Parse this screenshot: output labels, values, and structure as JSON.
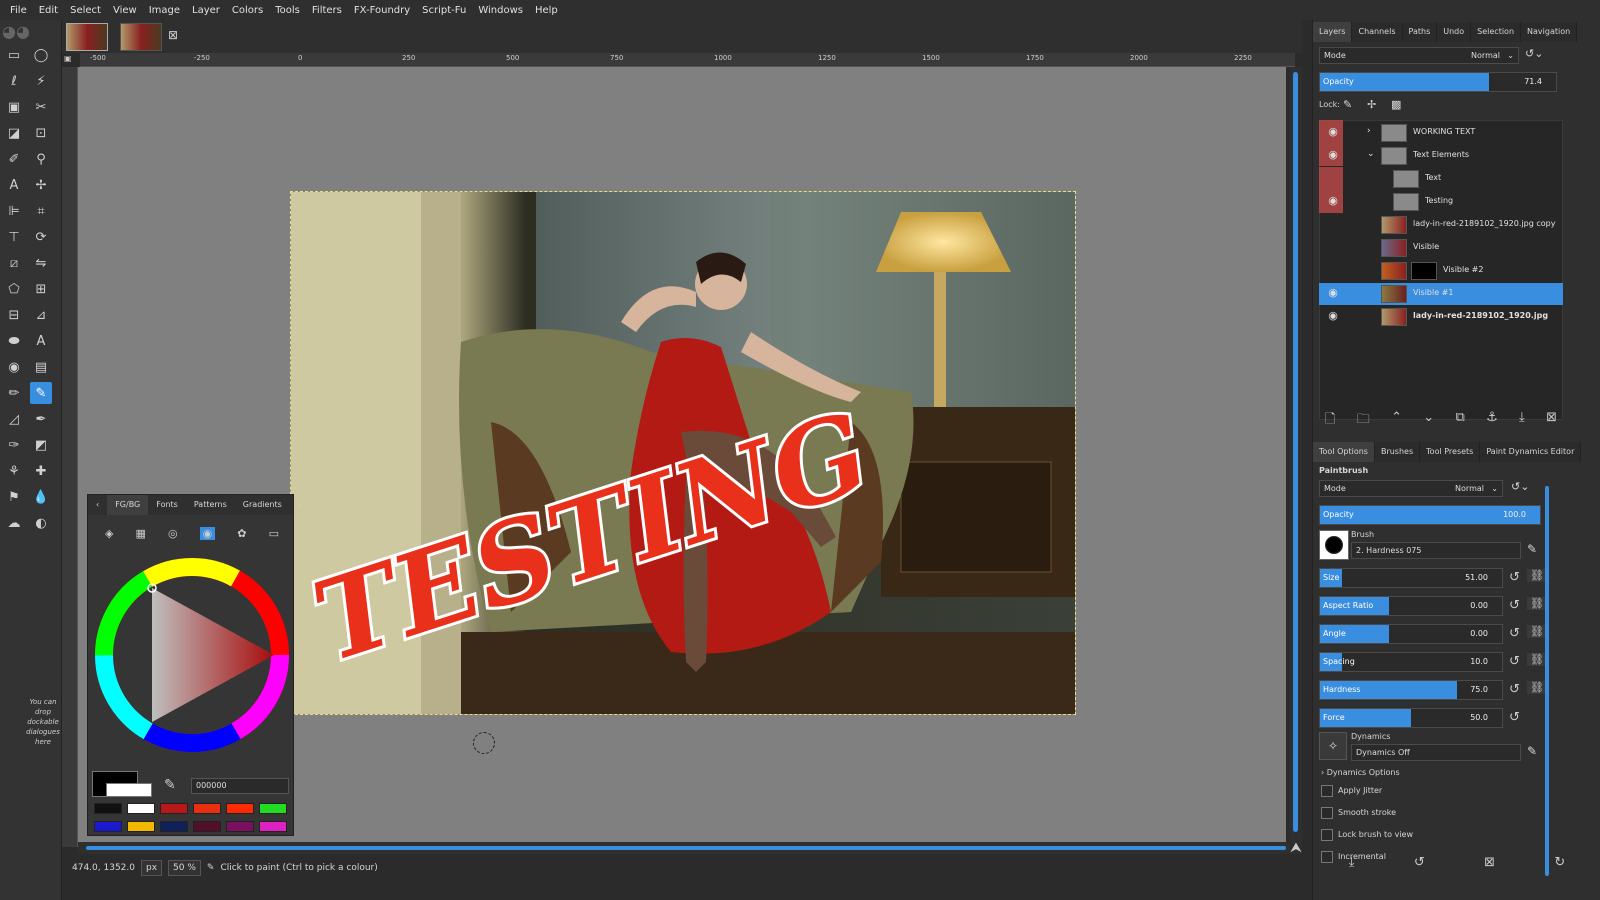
{
  "menu": [
    "File",
    "Edit",
    "Select",
    "View",
    "Image",
    "Layer",
    "Colors",
    "Tools",
    "Filters",
    "FX-Foundry",
    "Script-Fu",
    "Windows",
    "Help"
  ],
  "toolbox": {
    "drop_hint": "You can drop dockable dialogues here"
  },
  "ruler": {
    "h_ticks": [
      "-500",
      "-250",
      "0",
      "250",
      "500",
      "750",
      "1000",
      "1250",
      "1500",
      "1750",
      "2000",
      "2250"
    ]
  },
  "canvas": {
    "overlay_text": "TESTING"
  },
  "statusbar": {
    "coords": "474.0, 1352.0",
    "unit": "px",
    "zoom": "50 %",
    "hint": "Click to paint (Ctrl to pick a colour)"
  },
  "fgbg": {
    "tabs": [
      "FG/BG",
      "Fonts",
      "Patterns",
      "Gradients"
    ],
    "hex": "000000",
    "swatches": [
      "#111111",
      "#ffffff",
      "#b81818",
      "#e83010",
      "#ff2a00",
      "#22dd22",
      "#1a1ad0",
      "#f2b800",
      "#10205a",
      "#50102a",
      "#7a1060",
      "#e020c0"
    ]
  },
  "layers_dock": {
    "tabs": [
      "Layers",
      "Channels",
      "Paths",
      "Undo",
      "Selection",
      "Navigation"
    ],
    "mode_label": "Mode",
    "mode_value": "Normal",
    "opacity_label": "Opacity",
    "opacity_value": "71.4",
    "opacity_fraction": 0.714,
    "lock_label": "Lock:",
    "layers": [
      {
        "name": "WORKING TEXT",
        "visible": true
      },
      {
        "name": "Text Elements",
        "visible": true
      },
      {
        "name": "Text",
        "visible": false
      },
      {
        "name": "Testing",
        "visible": true
      },
      {
        "name": "lady-in-red-2189102_1920.jpg copy",
        "visible": false
      },
      {
        "name": "Visible",
        "visible": false
      },
      {
        "name": "Visible #2",
        "visible": false
      },
      {
        "name": "Visible #1",
        "visible": true,
        "selected": true
      },
      {
        "name": "lady-in-red-2189102_1920.jpg",
        "visible": true
      }
    ]
  },
  "tool_options": {
    "tabs": [
      "Tool Options",
      "Brushes",
      "Tool Presets",
      "Paint Dynamics Editor"
    ],
    "title": "Paintbrush",
    "mode_label": "Mode",
    "mode_value": "Normal",
    "opacity_label": "Opacity",
    "opacity_value": "100.0",
    "brush_label": "Brush",
    "brush_value": "2. Hardness 075",
    "sliders": [
      {
        "label": "Size",
        "value": "51.00",
        "fraction": 0.12
      },
      {
        "label": "Aspect Ratio",
        "value": "0.00",
        "fraction": 0.38
      },
      {
        "label": "Angle",
        "value": "0.00",
        "fraction": 0.38
      },
      {
        "label": "Spacing",
        "value": "10.0",
        "fraction": 0.12
      },
      {
        "label": "Hardness",
        "value": "75.0",
        "fraction": 0.75
      },
      {
        "label": "Force",
        "value": "50.0",
        "fraction": 0.5
      }
    ],
    "dynamics_label": "Dynamics",
    "dynamics_value": "Dynamics Off",
    "dynamics_options": "Dynamics Options",
    "checkboxes": [
      "Apply Jitter",
      "Smooth stroke",
      "Lock brush to view",
      "Incremental"
    ]
  },
  "colors": {
    "accent": "#3a8ee0",
    "canvas_bg": "#808080",
    "panel_bg": "#2f2f2f",
    "text_red": "#e8301a"
  }
}
